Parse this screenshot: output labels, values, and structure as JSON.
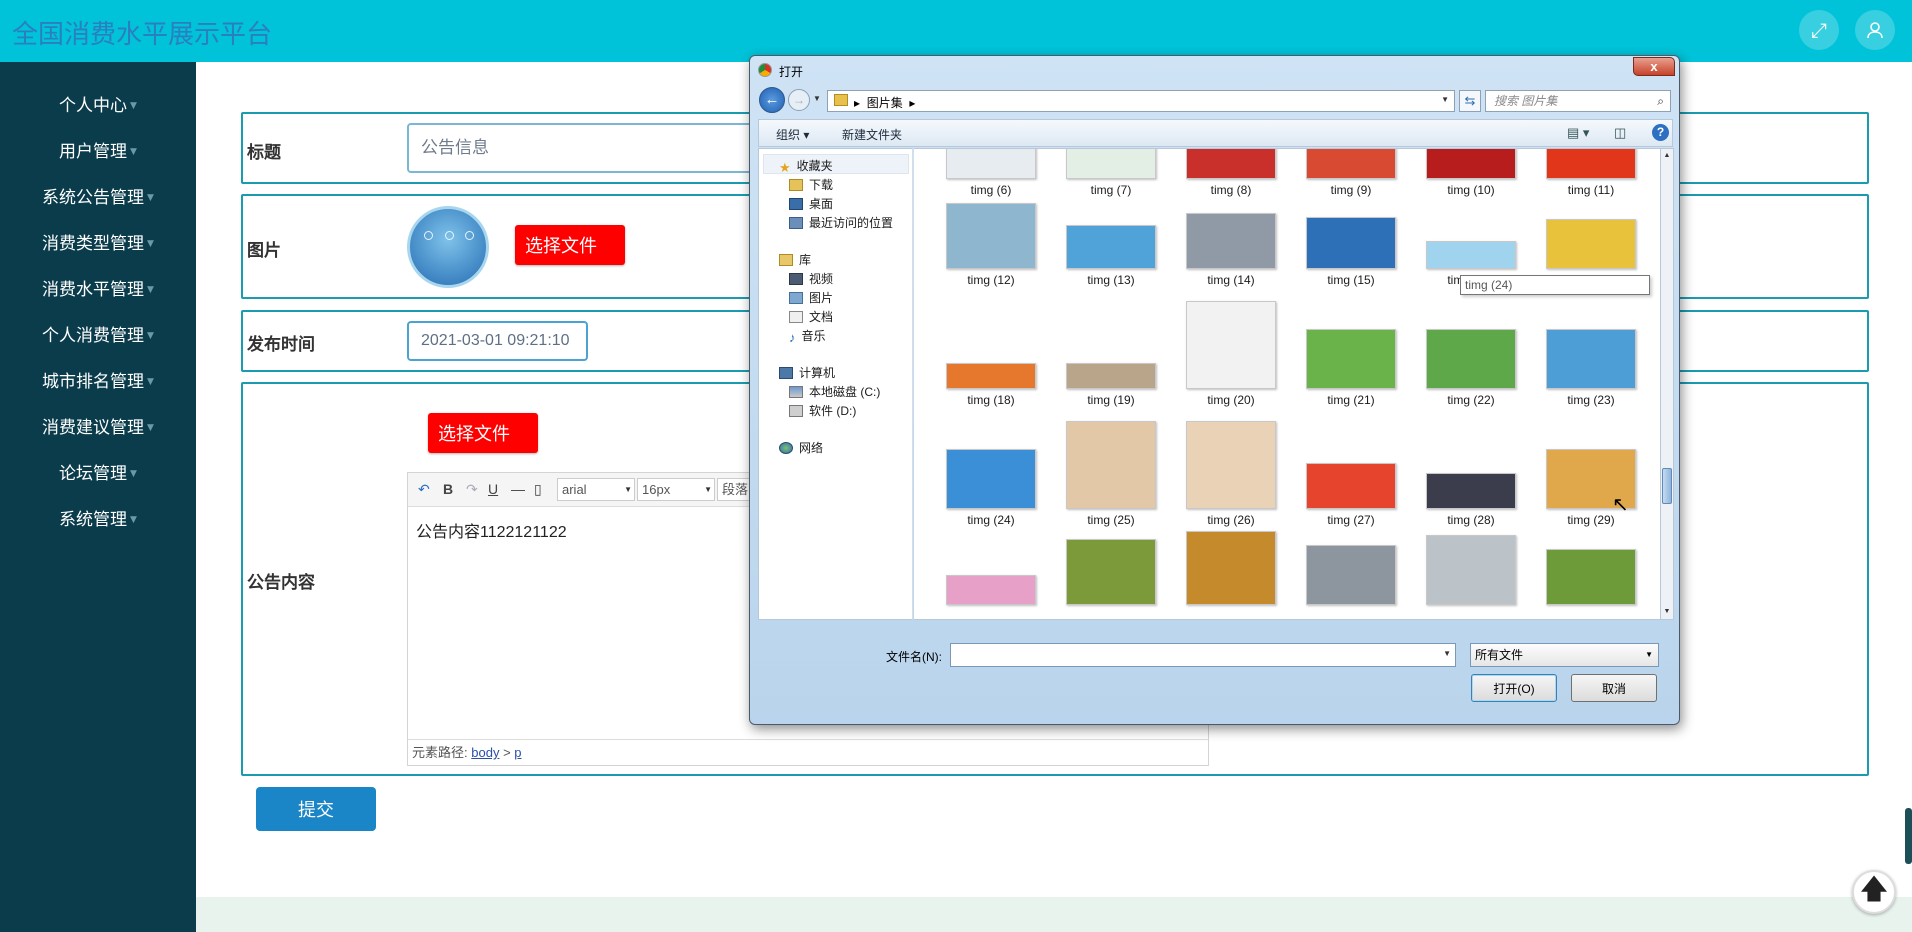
{
  "app": {
    "title": "全国消费水平展示平台"
  },
  "header": {
    "fullscreen_icon": "expand-icon",
    "user_icon": "user-icon"
  },
  "sidebar": {
    "items": [
      {
        "label": "个人中心"
      },
      {
        "label": "用户管理"
      },
      {
        "label": "系统公告管理"
      },
      {
        "label": "消费类型管理"
      },
      {
        "label": "消费水平管理"
      },
      {
        "label": "个人消费管理"
      },
      {
        "label": "城市排名管理"
      },
      {
        "label": "消费建议管理"
      },
      {
        "label": "论坛管理"
      },
      {
        "label": "系统管理"
      }
    ]
  },
  "form": {
    "title_label": "标题",
    "title_value": "公告信息",
    "image_label": "图片",
    "choose_file": "选择文件",
    "time_label": "发布时间",
    "time_value": "2021-03-01 09:21:10",
    "content_label": "公告内容",
    "content_choose_file": "选择文件",
    "submit": "提交"
  },
  "editor": {
    "font_family": "arial",
    "font_size": "16px",
    "paragraph": "段落",
    "body_text": "公告内容1122121122",
    "path_label": "元素路径:",
    "path_body": "body",
    "path_sep": ">",
    "path_p": "p"
  },
  "dialog": {
    "title": "打开",
    "close": "x",
    "breadcrumb": "图片集",
    "search_placeholder": "搜索 图片集",
    "organize": "组织",
    "new_folder": "新建文件夹",
    "nav": {
      "favorites": "收藏夹",
      "downloads": "下载",
      "desktop": "桌面",
      "recent": "最近访问的位置",
      "libraries": "库",
      "videos": "视频",
      "pictures": "图片",
      "documents": "文档",
      "music": "音乐",
      "computer": "计算机",
      "disk_c": "本地磁盘 (C:)",
      "disk_d": "软件 (D:)",
      "network": "网络"
    },
    "files": [
      {
        "name": "timg (6)",
        "color": "#e6ecef"
      },
      {
        "name": "timg (7)",
        "color": "#e3efe4"
      },
      {
        "name": "timg (8)",
        "color": "#c9302c"
      },
      {
        "name": "timg (9)",
        "color": "#d94a32"
      },
      {
        "name": "timg (10)",
        "color": "#b81d1d"
      },
      {
        "name": "timg (11)",
        "color": "#e2361b"
      },
      {
        "name": "timg (12)",
        "color": "#8fb6cf"
      },
      {
        "name": "timg (13)",
        "color": "#4fa3d9"
      },
      {
        "name": "timg (14)",
        "color": "#8f9aa6"
      },
      {
        "name": "timg (15)",
        "color": "#2e70b8"
      },
      {
        "name": "timg (16)",
        "color": "#9fd3ee"
      },
      {
        "name": "timg (17)",
        "color": "#e8c23a"
      },
      {
        "name": "timg (18)",
        "color": "#e5782d"
      },
      {
        "name": "timg (19)",
        "color": "#b9a58a"
      },
      {
        "name": "timg (20)",
        "color": "#f2f2f2"
      },
      {
        "name": "timg (21)",
        "color": "#6ab24a"
      },
      {
        "name": "timg (22)",
        "color": "#5ea84a"
      },
      {
        "name": "timg (23)",
        "color": "#4d9ed6"
      },
      {
        "name": "timg (24)",
        "color": "#3a8fd6"
      },
      {
        "name": "timg (25)",
        "color": "#e3c8a8"
      },
      {
        "name": "timg (26)",
        "color": "#ead2b6"
      },
      {
        "name": "timg (27)",
        "color": "#e7442d"
      },
      {
        "name": "timg (28)",
        "color": "#3b3c4c"
      },
      {
        "name": "timg (29)",
        "color": "#e0a84a"
      },
      {
        "name": "",
        "color": "#e7a0c8"
      },
      {
        "name": "",
        "color": "#7d9a3a"
      },
      {
        "name": "",
        "color": "#c48a2c"
      },
      {
        "name": "",
        "color": "#8d969e"
      },
      {
        "name": "",
        "color": "#bcc3c8"
      },
      {
        "name": "",
        "color": "#6e9b3a"
      }
    ],
    "tooltip": "timg (24)",
    "filename_label": "文件名(N):",
    "filename_value": "",
    "filetype": "所有文件",
    "open_button": "打开(O)",
    "cancel_button": "取消"
  }
}
